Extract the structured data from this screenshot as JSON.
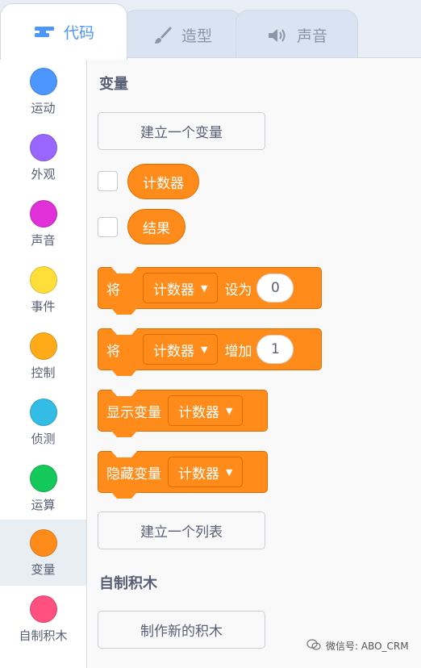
{
  "tabs": [
    {
      "label": "代码",
      "icon": "code-icon"
    },
    {
      "label": "造型",
      "icon": "brush-icon"
    },
    {
      "label": "声音",
      "icon": "speaker-icon"
    }
  ],
  "categories": [
    {
      "label": "运动",
      "color": "#4c97ff"
    },
    {
      "label": "外观",
      "color": "#9966ff"
    },
    {
      "label": "声音",
      "color": "#cf63cf"
    },
    {
      "label": "事件",
      "color": "#ffd500"
    },
    {
      "label": "控制",
      "color": "#ffab19"
    },
    {
      "label": "侦测",
      "color": "#5cb1d6"
    },
    {
      "label": "运算",
      "color": "#59c059"
    },
    {
      "label": "变量",
      "color": "#ff8c1a"
    },
    {
      "label": "自制积木",
      "color": "#ff6680"
    }
  ],
  "selected_category": "变量",
  "variables": {
    "title": "变量",
    "make_variable_label": "建立一个变量",
    "vars": [
      "计数器",
      "结果"
    ],
    "set_block": {
      "prefix": "将",
      "var": "计数器",
      "mid": "设为",
      "value": "0"
    },
    "change_block": {
      "prefix": "将",
      "var": "计数器",
      "mid": "增加",
      "value": "1"
    },
    "show_block": {
      "label": "显示变量",
      "var": "计数器"
    },
    "hide_block": {
      "label": "隐藏变量",
      "var": "计数器"
    },
    "make_list_label": "建立一个列表"
  },
  "my_blocks": {
    "title": "自制积木",
    "make_block_label": "制作新的积木"
  },
  "watermark": "微信号: ABO_CRM"
}
